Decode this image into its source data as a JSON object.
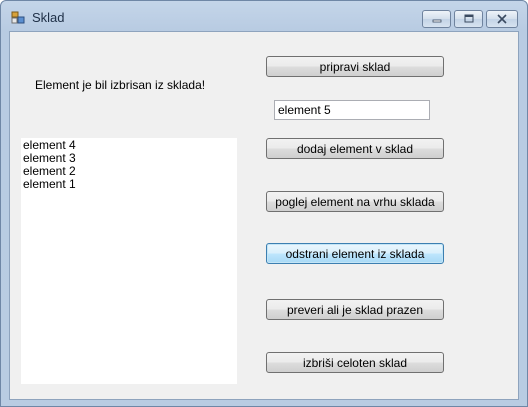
{
  "window": {
    "title": "Sklad"
  },
  "status": {
    "message": "Element je bil izbrisan iz sklada!"
  },
  "input": {
    "value": "element 5"
  },
  "stack_list": {
    "items": [
      "element 4",
      "element 3",
      "element 2",
      "element 1"
    ]
  },
  "buttons": {
    "prepare": "pripravi sklad",
    "add": "dodaj element v sklad",
    "peek": "poglej element na vrhu sklada",
    "remove": "odstrani element iz sklada",
    "is_empty": "preveri ali je sklad prazen",
    "clear": "izbriši celoten sklad"
  },
  "icons": {
    "app": "stack-app-icon",
    "minimize": "minimize-icon",
    "maximize": "maximize-icon",
    "close": "close-icon"
  }
}
